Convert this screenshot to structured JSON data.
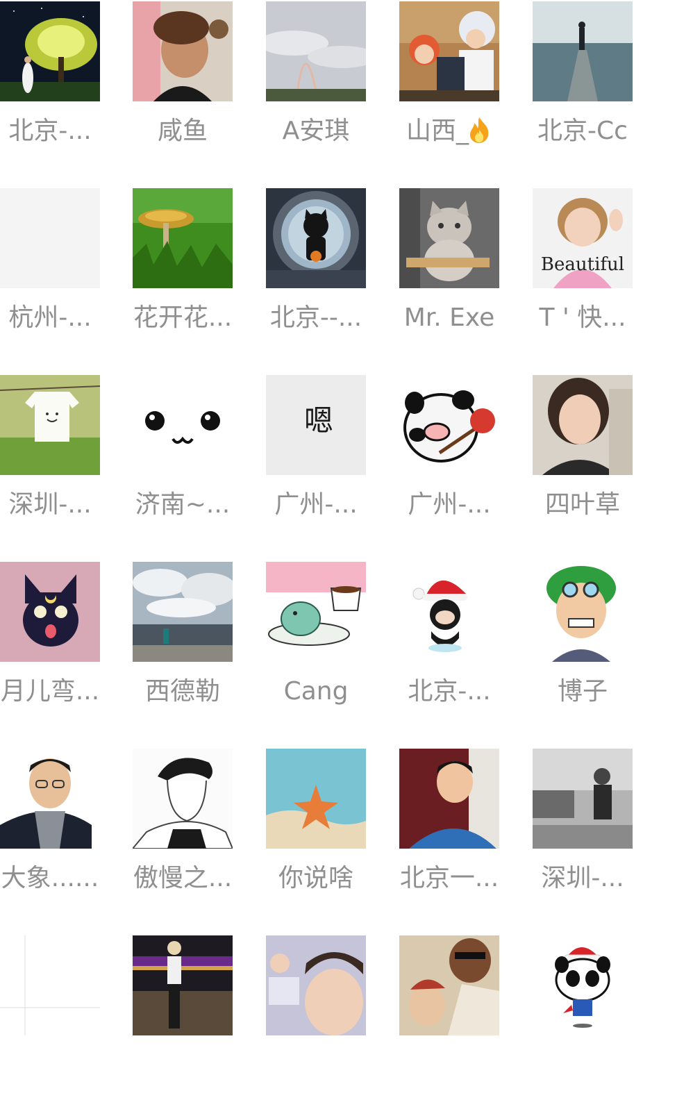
{
  "members": [
    {
      "name": "北京-...",
      "avatar_icon": "night-tree-couple-avatar"
    },
    {
      "name": "咸鱼",
      "avatar_icon": "curly-hair-man-avatar"
    },
    {
      "name": "A安琪",
      "avatar_icon": "rainbow-sky-avatar"
    },
    {
      "name": "山西_",
      "avatar_icon": "anime-characters-avatar",
      "badge_icon": "fire-emoji"
    },
    {
      "name": "北京-Cc",
      "avatar_icon": "sea-pier-silhouette-avatar"
    },
    {
      "name": "杭州-...",
      "avatar_icon": "blank-avatar"
    },
    {
      "name": "花开花...",
      "avatar_icon": "mushroom-grass-avatar"
    },
    {
      "name": "北京--...",
      "avatar_icon": "octocat-porthole-avatar"
    },
    {
      "name": "Mr. Exe",
      "avatar_icon": "gray-cat-avatar"
    },
    {
      "name": "T ' 快...",
      "avatar_icon": "thumbs-up-girl-avatar",
      "avatar_text": "Beautiful"
    },
    {
      "name": "深圳-...",
      "avatar_icon": "tshirt-clothesline-avatar"
    },
    {
      "name": "济南~...",
      "avatar_icon": "cute-face-avatar"
    },
    {
      "name": "广州-...",
      "avatar_icon": "calligraphy-avatar",
      "avatar_text": "嗯"
    },
    {
      "name": "广州-...",
      "avatar_icon": "panda-pig-bag-avatar"
    },
    {
      "name": "四叶草",
      "avatar_icon": "young-woman-avatar"
    },
    {
      "name": "月儿弯...",
      "avatar_icon": "black-cat-luna-avatar"
    },
    {
      "name": "西德勒",
      "avatar_icon": "cloudy-square-avatar"
    },
    {
      "name": "Cang",
      "avatar_icon": "dinosaur-coffee-avatar"
    },
    {
      "name": "北京-...",
      "avatar_icon": "santa-octocat-avatar"
    },
    {
      "name": "博子",
      "avatar_icon": "green-hair-anime-avatar"
    },
    {
      "name": "大象......",
      "avatar_icon": "man-glasses-scarf-avatar"
    },
    {
      "name": "傲慢之...",
      "avatar_icon": "sketch-man-avatar"
    },
    {
      "name": "你说啥",
      "avatar_icon": "starfish-beach-avatar"
    },
    {
      "name": "北京一...",
      "avatar_icon": "smiling-man-blue-avatar"
    },
    {
      "name": "深圳-...",
      "avatar_icon": "bw-street-man-avatar"
    },
    {
      "name": "",
      "avatar_icon": "blank-lines-avatar"
    },
    {
      "name": "",
      "avatar_icon": "woman-night-bridge-avatar"
    },
    {
      "name": "",
      "avatar_icon": "child-face-avatar"
    },
    {
      "name": "",
      "avatar_icon": "couple-drawing-avatar"
    },
    {
      "name": "",
      "avatar_icon": "santa-panda-avatar"
    }
  ],
  "colors": {
    "name_text": "#8f8f8f",
    "background": "#ffffff"
  }
}
